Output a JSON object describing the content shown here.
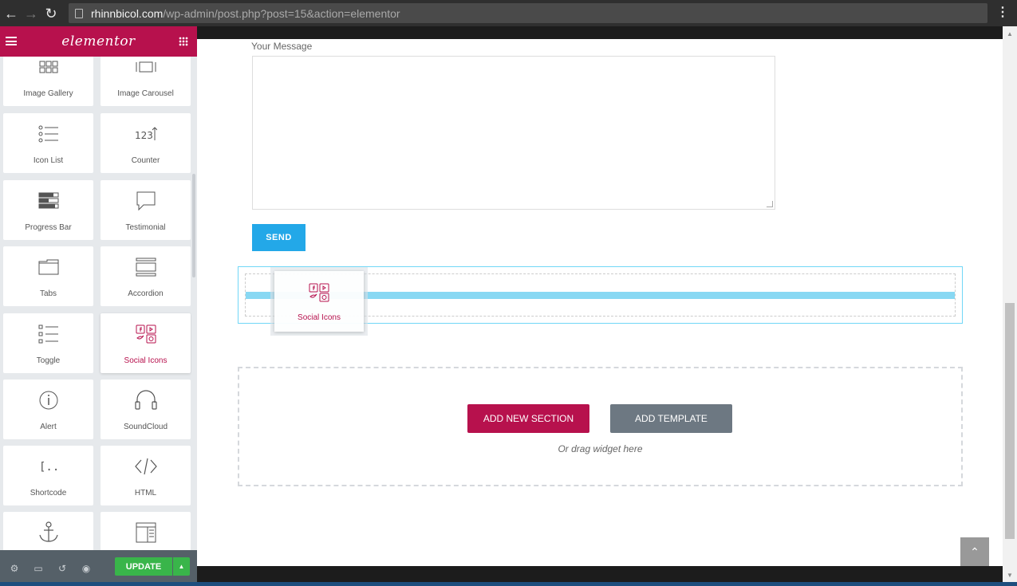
{
  "browser": {
    "url_host": "rhinnbicol.com",
    "url_path": "/wp-admin/post.php?post=15&action=elementor"
  },
  "panel": {
    "logo_text": "elementor",
    "widgets": [
      {
        "label": "Image Gallery",
        "icon": "image-gallery-icon"
      },
      {
        "label": "Image Carousel",
        "icon": "image-carousel-icon"
      },
      {
        "label": "Icon List",
        "icon": "icon-list-icon"
      },
      {
        "label": "Counter",
        "icon": "counter-icon"
      },
      {
        "label": "Progress Bar",
        "icon": "progress-bar-icon"
      },
      {
        "label": "Testimonial",
        "icon": "testimonial-icon"
      },
      {
        "label": "Tabs",
        "icon": "tabs-icon"
      },
      {
        "label": "Accordion",
        "icon": "accordion-icon"
      },
      {
        "label": "Toggle",
        "icon": "toggle-icon"
      },
      {
        "label": "Social Icons",
        "icon": "social-icons-icon",
        "active": true
      },
      {
        "label": "Alert",
        "icon": "alert-icon"
      },
      {
        "label": "SoundCloud",
        "icon": "soundcloud-icon"
      },
      {
        "label": "Shortcode",
        "icon": "shortcode-icon"
      },
      {
        "label": "HTML",
        "icon": "html-icon"
      },
      {
        "label": "",
        "icon": "anchor-icon"
      },
      {
        "label": "",
        "icon": "sidebar-icon"
      }
    ],
    "footer": {
      "update_label": "UPDATE"
    }
  },
  "preview": {
    "form": {
      "message_label": "Your Message",
      "send_label": "SEND"
    },
    "dragging_widget": {
      "label": "Social Icons"
    },
    "add_section": {
      "add_new_label": "ADD NEW SECTION",
      "add_template_label": "ADD TEMPLATE",
      "hint": "Or drag widget here"
    }
  },
  "colors": {
    "brand": "#b7114d",
    "send": "#23a8e8",
    "update": "#39b54a",
    "drop_indicator": "#88d8f3"
  }
}
